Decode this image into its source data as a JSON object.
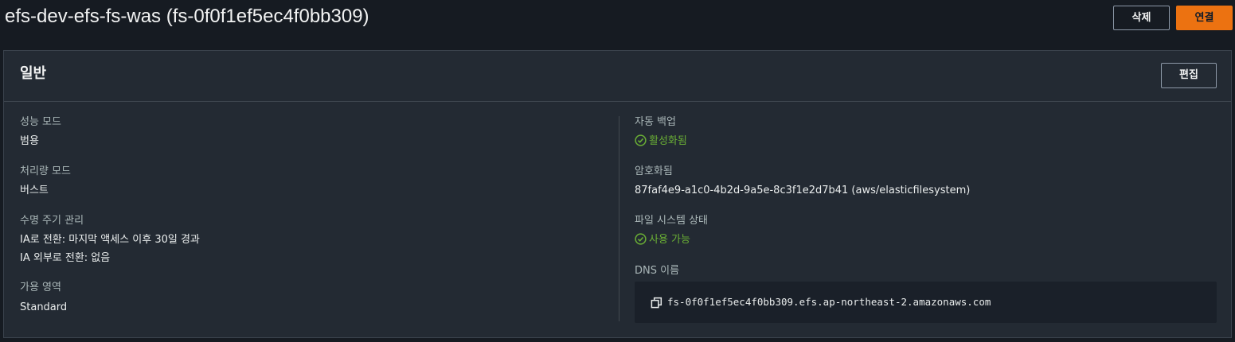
{
  "header": {
    "title": "efs-dev-efs-fs-was (fs-0f0f1ef5ec4f0bb309)",
    "delete_label": "삭제",
    "connect_label": "연결"
  },
  "panel": {
    "title": "일반",
    "edit_label": "편집",
    "left": {
      "performance_mode_label": "성능 모드",
      "performance_mode_value": "범용",
      "throughput_mode_label": "처리량 모드",
      "throughput_mode_value": "버스트",
      "lifecycle_label": "수명 주기 관리",
      "lifecycle_line1": "IA로 전환: 마지막 액세스 이후 30일 경과",
      "lifecycle_line2": "IA 외부로 전환: 없음",
      "availability_label": "가용 영역",
      "availability_value": "Standard"
    },
    "right": {
      "auto_backup_label": "자동 백업",
      "auto_backup_value": "활성화됨",
      "encrypted_label": "암호화됨",
      "encrypted_value": "87faf4e9-a1c0-4b2d-9a5e-8c3f1e2d7b41 (aws/elasticfilesystem)",
      "fs_state_label": "파일 시스템 상태",
      "fs_state_value": "사용 가능",
      "dns_label": "DNS 이름",
      "dns_value": "fs-0f0f1ef5ec4f0bb309.efs.ap-northeast-2.amazonaws.com"
    }
  },
  "colors": {
    "accent": "#ec7211",
    "success": "#6aaf35",
    "panel_bg": "#232a33",
    "page_bg": "#161b22"
  },
  "icons": [
    "check-circle-icon",
    "copy-icon"
  ]
}
